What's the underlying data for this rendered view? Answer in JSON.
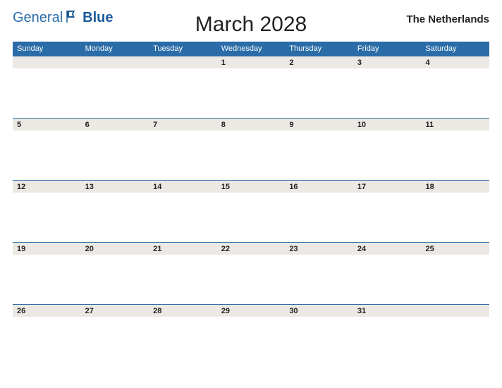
{
  "logo": {
    "text1": "General",
    "text2": "Blue"
  },
  "title": "March 2028",
  "region": "The Netherlands",
  "dayNames": [
    "Sunday",
    "Monday",
    "Tuesday",
    "Wednesday",
    "Thursday",
    "Friday",
    "Saturday"
  ],
  "weeks": [
    [
      "",
      "",
      "",
      "1",
      "2",
      "3",
      "4"
    ],
    [
      "5",
      "6",
      "7",
      "8",
      "9",
      "10",
      "11"
    ],
    [
      "12",
      "13",
      "14",
      "15",
      "16",
      "17",
      "18"
    ],
    [
      "19",
      "20",
      "21",
      "22",
      "23",
      "24",
      "25"
    ],
    [
      "26",
      "27",
      "28",
      "29",
      "30",
      "31",
      ""
    ]
  ],
  "colors": {
    "accent": "#2a6ca8",
    "rowBg": "#ece9e4"
  }
}
